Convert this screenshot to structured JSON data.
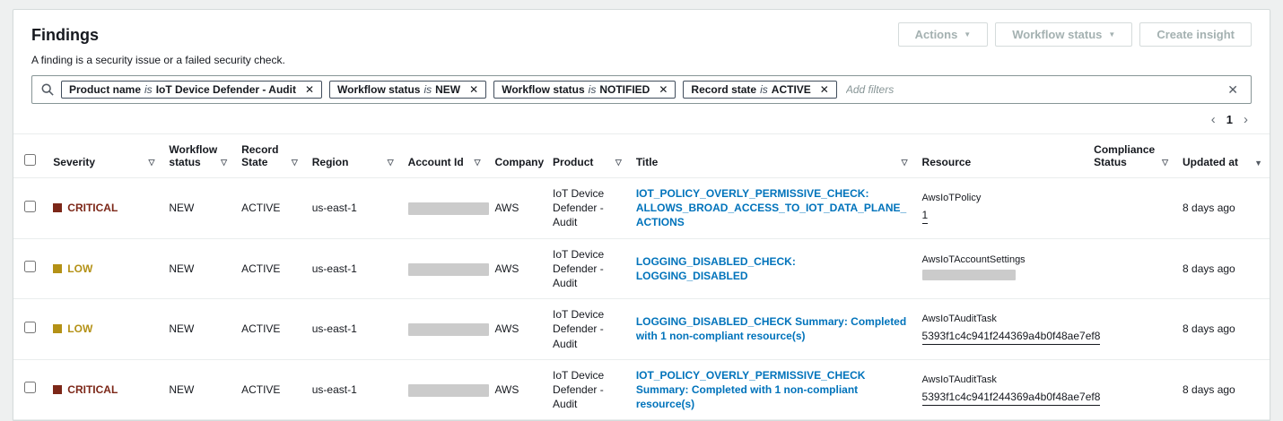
{
  "page": {
    "title": "Findings",
    "description": "A finding is a security issue or a failed security check."
  },
  "toolbar": {
    "actions_label": "Actions",
    "workflow_status_label": "Workflow status",
    "create_insight_label": "Create insight"
  },
  "filters": {
    "placeholder": "Add filters",
    "chips": [
      {
        "field": "Product name",
        "operator": "is",
        "value": "IoT Device Defender - Audit"
      },
      {
        "field": "Workflow status",
        "operator": "is",
        "value": "NEW"
      },
      {
        "field": "Workflow status",
        "operator": "is",
        "value": "NOTIFIED"
      },
      {
        "field": "Record state",
        "operator": "is",
        "value": "ACTIVE"
      }
    ]
  },
  "pagination": {
    "current_page": "1"
  },
  "icons": {
    "caret_down": "▼",
    "sortable": "▽",
    "sort_desc": "▼",
    "chip_close": "✕",
    "clear": "✕",
    "prev": "‹",
    "next": "›",
    "search": "magnifier"
  },
  "colors": {
    "severity": {
      "CRITICAL": "#7c2718",
      "LOW": "#b49116"
    },
    "link": "#0073bb"
  },
  "table": {
    "columns": [
      {
        "label": "Severity",
        "sort": "sortable"
      },
      {
        "label": "Workflow status",
        "sort": "sortable"
      },
      {
        "label": "Record State",
        "sort": "sortable"
      },
      {
        "label": "Region",
        "sort": "sortable"
      },
      {
        "label": "Account Id",
        "sort": "sortable"
      },
      {
        "label": "Company",
        "sort": "none"
      },
      {
        "label": "Product",
        "sort": "sortable"
      },
      {
        "label": "Title",
        "sort": "sortable"
      },
      {
        "label": "Resource",
        "sort": "none"
      },
      {
        "label": "Compliance Status",
        "sort": "sortable"
      },
      {
        "label": "Updated at",
        "sort": "desc"
      }
    ],
    "rows": [
      {
        "severity": "CRITICAL",
        "workflow_status": "NEW",
        "record_state": "ACTIVE",
        "region": "us-east-1",
        "account_id_redacted": true,
        "company": "AWS",
        "product": "IoT Device Defender - Audit",
        "title": "IOT_POLICY_OVERLY_PERMISSIVE_CHECK: ALLOWS_BROAD_ACCESS_TO_IOT_DATA_PLANE_ACTIONS",
        "resource_type": "AwsIoTPolicy",
        "resource_id": "1",
        "resource_id_redacted": false,
        "compliance_status": "",
        "updated_at": "8 days ago"
      },
      {
        "severity": "LOW",
        "workflow_status": "NEW",
        "record_state": "ACTIVE",
        "region": "us-east-1",
        "account_id_redacted": true,
        "company": "AWS",
        "product": "IoT Device Defender - Audit",
        "title": "LOGGING_DISABLED_CHECK: LOGGING_DISABLED",
        "resource_type": "AwsIoTAccountSettings",
        "resource_id": "",
        "resource_id_redacted": true,
        "compliance_status": "",
        "updated_at": "8 days ago"
      },
      {
        "severity": "LOW",
        "workflow_status": "NEW",
        "record_state": "ACTIVE",
        "region": "us-east-1",
        "account_id_redacted": true,
        "company": "AWS",
        "product": "IoT Device Defender - Audit",
        "title": "LOGGING_DISABLED_CHECK Summary: Completed with 1 non-compliant resource(s)",
        "resource_type": "AwsIoTAuditTask",
        "resource_id": "5393f1c4c941f244369a4b0f48ae7ef8",
        "resource_id_redacted": false,
        "compliance_status": "",
        "updated_at": "8 days ago"
      },
      {
        "severity": "CRITICAL",
        "workflow_status": "NEW",
        "record_state": "ACTIVE",
        "region": "us-east-1",
        "account_id_redacted": true,
        "company": "AWS",
        "product": "IoT Device Defender - Audit",
        "title": "IOT_POLICY_OVERLY_PERMISSIVE_CHECK Summary: Completed with 1 non-compliant resource(s)",
        "resource_type": "AwsIoTAuditTask",
        "resource_id": "5393f1c4c941f244369a4b0f48ae7ef8",
        "resource_id_redacted": false,
        "compliance_status": "",
        "updated_at": "8 days ago"
      }
    ]
  }
}
